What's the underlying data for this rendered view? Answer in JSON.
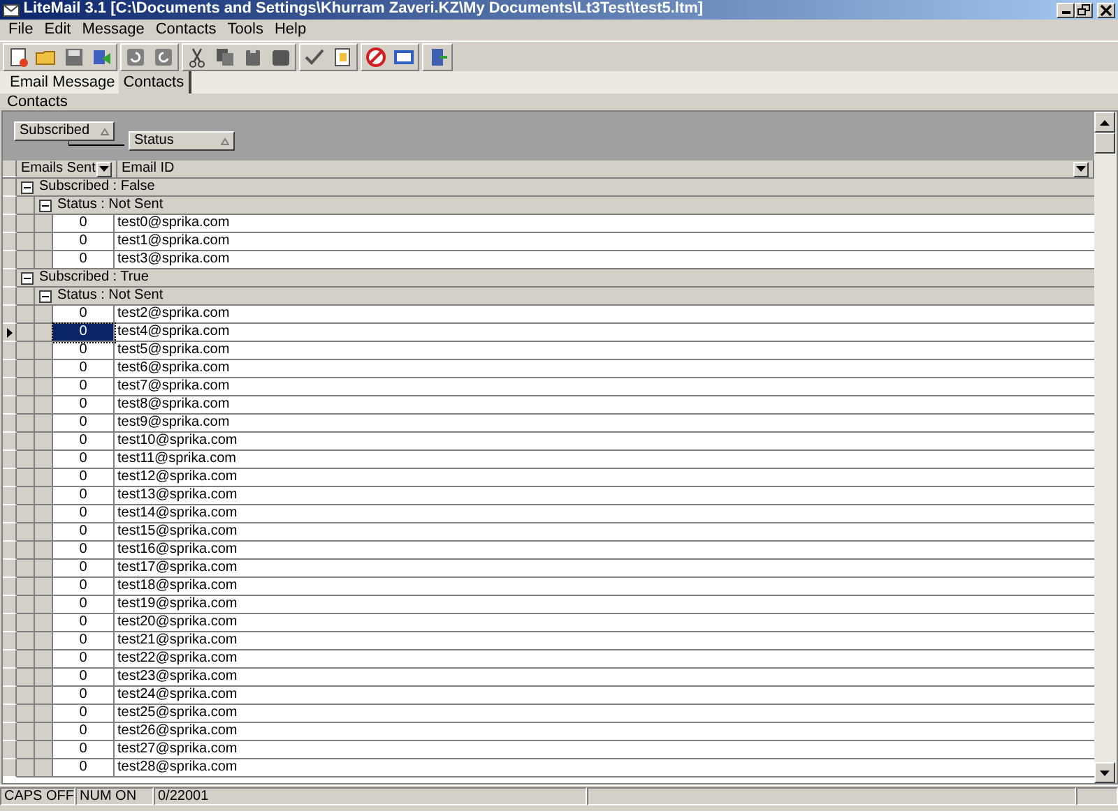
{
  "window": {
    "title": "LiteMail 3.1 [C:\\Documents and Settings\\Khurram Zaveri.KZ\\My Documents\\Lt3Test\\test5.ltm]"
  },
  "menu": [
    "File",
    "Edit",
    "Message",
    "Contacts",
    "Tools",
    "Help"
  ],
  "tabs": [
    {
      "label": "Email Message",
      "selected": false
    },
    {
      "label": "Contacts",
      "selected": true
    }
  ],
  "panel": {
    "label": "Contacts"
  },
  "group_by": [
    {
      "label": "Subscribed"
    },
    {
      "label": "Status"
    }
  ],
  "columns": [
    {
      "label": "Emails Sent"
    },
    {
      "label": "Email ID"
    }
  ],
  "groups": [
    {
      "label": "Subscribed : False",
      "expanded": true,
      "children": [
        {
          "label": "Status : Not Sent",
          "expanded": true,
          "rows": [
            {
              "emails_sent": "0",
              "email_id": "test0@sprika.com",
              "selected": false
            },
            {
              "emails_sent": "0",
              "email_id": "test1@sprika.com",
              "selected": false
            },
            {
              "emails_sent": "0",
              "email_id": "test3@sprika.com",
              "selected": false
            }
          ]
        }
      ]
    },
    {
      "label": "Subscribed : True",
      "expanded": true,
      "children": [
        {
          "label": "Status : Not Sent",
          "expanded": true,
          "rows": [
            {
              "emails_sent": "0",
              "email_id": "test2@sprika.com",
              "selected": false
            },
            {
              "emails_sent": "0",
              "email_id": "test4@sprika.com",
              "selected": true
            },
            {
              "emails_sent": "0",
              "email_id": "test5@sprika.com",
              "selected": false
            },
            {
              "emails_sent": "0",
              "email_id": "test6@sprika.com",
              "selected": false
            },
            {
              "emails_sent": "0",
              "email_id": "test7@sprika.com",
              "selected": false
            },
            {
              "emails_sent": "0",
              "email_id": "test8@sprika.com",
              "selected": false
            },
            {
              "emails_sent": "0",
              "email_id": "test9@sprika.com",
              "selected": false
            },
            {
              "emails_sent": "0",
              "email_id": "test10@sprika.com",
              "selected": false
            },
            {
              "emails_sent": "0",
              "email_id": "test11@sprika.com",
              "selected": false
            },
            {
              "emails_sent": "0",
              "email_id": "test12@sprika.com",
              "selected": false
            },
            {
              "emails_sent": "0",
              "email_id": "test13@sprika.com",
              "selected": false
            },
            {
              "emails_sent": "0",
              "email_id": "test14@sprika.com",
              "selected": false
            },
            {
              "emails_sent": "0",
              "email_id": "test15@sprika.com",
              "selected": false
            },
            {
              "emails_sent": "0",
              "email_id": "test16@sprika.com",
              "selected": false
            },
            {
              "emails_sent": "0",
              "email_id": "test17@sprika.com",
              "selected": false
            },
            {
              "emails_sent": "0",
              "email_id": "test18@sprika.com",
              "selected": false
            },
            {
              "emails_sent": "0",
              "email_id": "test19@sprika.com",
              "selected": false
            },
            {
              "emails_sent": "0",
              "email_id": "test20@sprika.com",
              "selected": false
            },
            {
              "emails_sent": "0",
              "email_id": "test21@sprika.com",
              "selected": false
            },
            {
              "emails_sent": "0",
              "email_id": "test22@sprika.com",
              "selected": false
            },
            {
              "emails_sent": "0",
              "email_id": "test23@sprika.com",
              "selected": false
            },
            {
              "emails_sent": "0",
              "email_id": "test24@sprika.com",
              "selected": false
            },
            {
              "emails_sent": "0",
              "email_id": "test25@sprika.com",
              "selected": false
            },
            {
              "emails_sent": "0",
              "email_id": "test26@sprika.com",
              "selected": false
            },
            {
              "emails_sent": "0",
              "email_id": "test27@sprika.com",
              "selected": false
            },
            {
              "emails_sent": "0",
              "email_id": "test28@sprika.com",
              "selected": false
            }
          ]
        }
      ]
    }
  ],
  "status_bar": [
    "CAPS OFF",
    "NUM ON",
    "0/22001"
  ]
}
